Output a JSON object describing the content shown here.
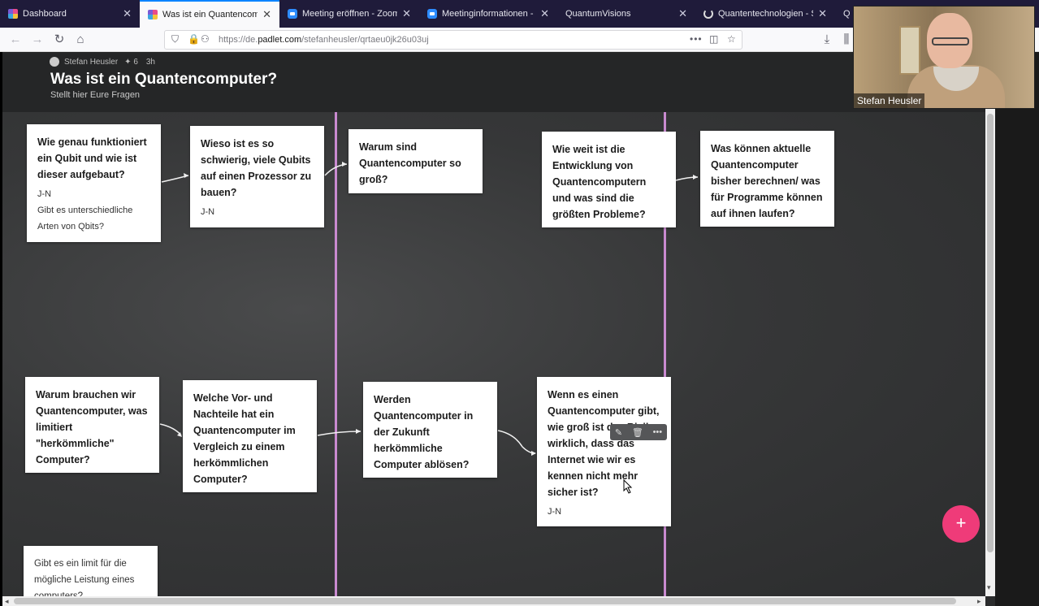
{
  "browser": {
    "tabs": [
      {
        "label": "Dashboard",
        "icon": "padlet-icon",
        "active": false
      },
      {
        "label": "Was ist ein Quantencomput",
        "icon": "padlet-icon",
        "active": true
      },
      {
        "label": "Meeting eröffnen - Zoom",
        "icon": "zoom-icon",
        "active": false
      },
      {
        "label": "Meetinginformationen - Zo",
        "icon": "zoom-icon",
        "active": false
      },
      {
        "label": "QuantumVisions",
        "icon": "",
        "active": false
      },
      {
        "label": "Quantentechnologien - Star",
        "icon": "loading-icon",
        "active": false
      },
      {
        "label": "Q",
        "icon": "",
        "active": false
      }
    ],
    "close_glyph": "✕",
    "url_prefix": "https://de.",
    "url_domain": "padlet.com",
    "url_path": "/stefanheusler/qrtaeu0jk26u03uj"
  },
  "padlet": {
    "author": "Stefan Heusler",
    "likes": "✦ 6",
    "age": "3h",
    "title": "Was ist ein Quantencomputer?",
    "subtitle": "Stellt hier Eure Fragen"
  },
  "cards": [
    {
      "question": "Wie genau funktioniert ein Qubit und wie ist dieser aufgebaut?",
      "author": "J-N",
      "sub": "Gibt es unterschiedliche Arten von Qbits?"
    },
    {
      "question": "Wieso ist es so schwierig, viele Qubits auf einen Prozessor zu bauen?",
      "author": "J-N",
      "sub": ""
    },
    {
      "question": "Warum sind Quantencomputer so groß?",
      "author": "",
      "sub": ""
    },
    {
      "question": "Wie weit ist die Entwicklung von Quantencomputern und was sind die größten Probleme?",
      "author": "",
      "sub": ""
    },
    {
      "question": "Was können aktuelle Quantencomputer bisher berechnen/ was für Programme können auf ihnen laufen?",
      "author": "",
      "sub": ""
    },
    {
      "question": "Warum brauchen wir Quantencomputer, was limitiert \"herkömmliche\" Computer?",
      "author": "",
      "sub": ""
    },
    {
      "question": "Welche Vor- und Nachteile hat ein Quantencomputer im Vergleich zu einem herkömmlichen Computer?",
      "author": "",
      "sub": ""
    },
    {
      "question": "Werden Quantencomputer in der Zukunft herkömmliche Computer ablösen?",
      "author": "",
      "sub": ""
    },
    {
      "question": "Wenn es einen Quantencomputer gibt, wie groß ist das Risiko wirklich, dass das Internet wie wir es kennen nicht mehr sicher ist?",
      "author": "J-N",
      "sub": ""
    },
    {
      "question": "Gibt es ein limit für die mögliche Leistung eines computers?",
      "author": "",
      "sub": ""
    }
  ],
  "card_tools": {
    "edit": "✎",
    "delete": "🗑",
    "more": "•••"
  },
  "fab_label": "+",
  "video": {
    "participant_name": "Stefan Heusler"
  }
}
